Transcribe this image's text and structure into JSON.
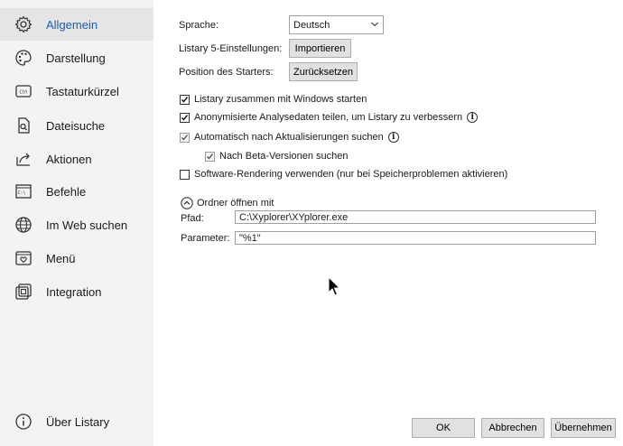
{
  "sidebar": {
    "items": [
      {
        "label": "Allgemein",
        "icon": "gear-icon",
        "active": true
      },
      {
        "label": "Darstellung",
        "icon": "palette-icon"
      },
      {
        "label": "Tastaturkürzel",
        "icon": "keyboard-ctrl-icon"
      },
      {
        "label": "Dateisuche",
        "icon": "file-search-icon"
      },
      {
        "label": "Aktionen",
        "icon": "share-arrow-icon"
      },
      {
        "label": "Befehle",
        "icon": "terminal-icon"
      },
      {
        "label": "Im Web suchen",
        "icon": "globe-icon"
      },
      {
        "label": "Menü",
        "icon": "menu-heart-icon"
      },
      {
        "label": "Integration",
        "icon": "integration-icon"
      }
    ],
    "about": {
      "label": "Über Listary",
      "icon": "info-circle-icon"
    }
  },
  "settings": {
    "language_label": "Sprache:",
    "language_value": "Deutsch",
    "listary5_label": "Listary 5-Einstellungen:",
    "import_button": "Importieren",
    "launcher_pos_label": "Position des Starters:",
    "reset_button": "Zurücksetzen",
    "checkboxes": {
      "start_with_windows": {
        "label": "Listary zusammen mit Windows starten",
        "checked": true
      },
      "analytics": {
        "label": "Anonymisierte Analysedaten teilen, um Listary zu verbessern",
        "checked": true
      },
      "auto_update": {
        "label": "Automatisch nach Aktualisierungen suchen",
        "checked": true
      },
      "beta": {
        "label": "Nach Beta-Versionen suchen",
        "checked": true
      },
      "software_rendering": {
        "label": "Software-Rendering verwenden (nur bei Speicherproblemen aktivieren)",
        "checked": false
      }
    },
    "open_folder": {
      "section_label": "Ordner öffnen mit",
      "path_label": "Pfad:",
      "path_value": "C:\\Xyplorer\\XYplorer.exe",
      "params_label": "Parameter:",
      "params_value": "\"%1\""
    }
  },
  "footer": {
    "ok": "OK",
    "cancel": "Abbrechen",
    "apply": "Übernehmen"
  },
  "colors": {
    "sidebar_bg": "#f3f3f3",
    "active_bg": "#e5e5e5",
    "accent": "#1a5fb4"
  }
}
